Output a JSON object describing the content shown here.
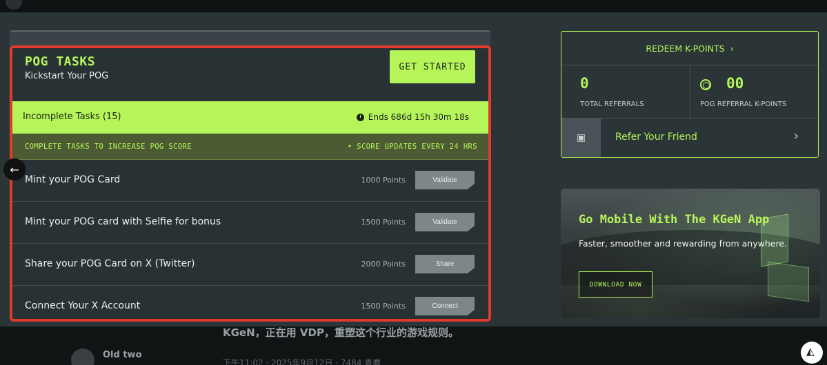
{
  "tasks": {
    "title": "POG TASKS",
    "subtitle": "Kickstart Your POG",
    "get_started": "GET STARTED",
    "incomplete": "Incomplete Tasks  (15)",
    "ends": "Ends 686d 15h 30m 18s",
    "info_left": "COMPLETE TASKS TO INCREASE POG SCORE",
    "info_right": "• SCORE UPDATES EVERY 24 HRS",
    "items": [
      {
        "name": "Mint your POG Card",
        "points": "1000 Points",
        "action": "Validate"
      },
      {
        "name": "Mint your POG card with Selfie for bonus",
        "points": "1500 Points",
        "action": "Validate"
      },
      {
        "name": "Share your POG Card on X (Twitter)",
        "points": "2000 Points",
        "action": "Share"
      },
      {
        "name": "Connect Your X Account",
        "points": "1500 Points",
        "action": "Connect"
      }
    ]
  },
  "redeem": {
    "link": "REDEEM K-POINTS",
    "referrals_value": "0",
    "referrals_label": "TOTAL REFERRALS",
    "kpoints_value": "00",
    "kpoints_label": "POG REFERRAL K-POINTS",
    "refer_label": "Refer Your Friend"
  },
  "promo": {
    "title": "Go Mobile With The KGeN App",
    "subtitle": "Faster, smoother and rewarding from anywhere.",
    "download": "DOWNLOAD NOW"
  },
  "background": {
    "text": "KGeN，正在用 VDP，重塑这个行业的游戏规则。",
    "user": "Old two",
    "date": "下午11:02 · 2025年9月12日 · 7484 查看"
  }
}
